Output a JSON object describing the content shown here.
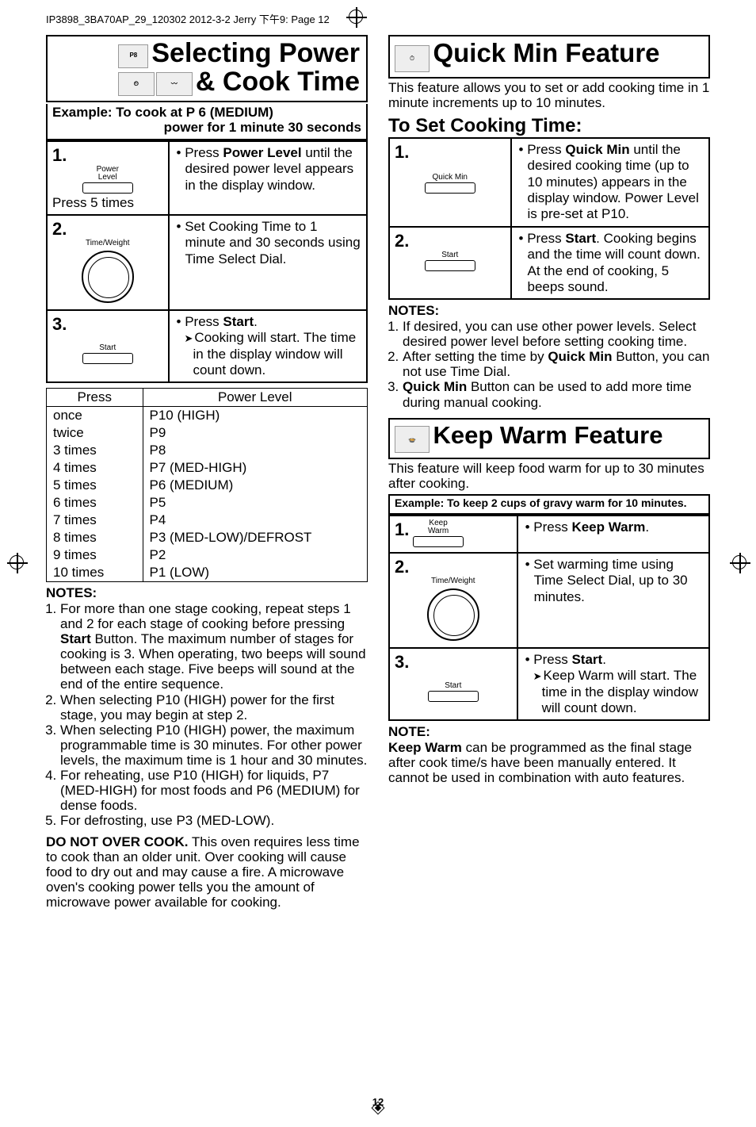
{
  "header": "IP3898_3BA70AP_29_120302  2012-3-2  Jerry 下午9:  Page 12",
  "page_number": "12",
  "left": {
    "title_line1": "Selecting Power",
    "title_line2": "& Cook Time",
    "example_l1": "Example: To cook at P 6 (MEDIUM)",
    "example_l2": "power for 1 minute 30 seconds",
    "steps": [
      {
        "num": "1.",
        "btn_l1": "Power",
        "btn_l2": "Level",
        "extra_text": "Press 5 times",
        "bullets": [
          "• Press ",
          "• Press <b>Power Level</b> until the desired power level appears in the display window."
        ],
        "bullet_html": "Power Level",
        "bullet_after": " until the desired power level appears in the display window."
      },
      {
        "num": "2.",
        "btn_l1": "Time/Weight",
        "bullet": "• Set Cooking Time to 1 minute and 30 seconds using Time Select Dial."
      },
      {
        "num": "3.",
        "btn_l1": "Start",
        "bullet_pre": "• Press ",
        "bullet_bold": "Start",
        "bullet_post": ".",
        "arrow_line": "Cooking will start. The time in the display window will count down."
      }
    ],
    "power_header_l": "Press",
    "power_header_r": "Power Level",
    "power_rows": [
      [
        "once",
        "P10 (HIGH)"
      ],
      [
        "twice",
        "P9"
      ],
      [
        "3 times",
        "P8"
      ],
      [
        "4 times",
        "P7 (MED-HIGH)"
      ],
      [
        "5 times",
        "P6 (MEDIUM)"
      ],
      [
        "6 times",
        "P5"
      ],
      [
        "7 times",
        "P4"
      ],
      [
        "8 times",
        "P3 (MED-LOW)/DEFROST"
      ],
      [
        "9 times",
        "P2"
      ],
      [
        "10 times",
        "P1 (LOW)"
      ]
    ],
    "notes_h": "NOTES:",
    "notes": [
      "For more than one stage cooking, repeat steps 1 and 2 for each stage of cooking before pressing <b>Start</b> Button. The maximum number of stages for cooking is 3. When operating, two beeps will sound between each stage. Five beeps will sound at the end of the entire sequence.",
      "When selecting P10 (HIGH) power for the first stage, you may begin at step 2.",
      "When selecting P10 (HIGH) power, the maximum programmable time is 30 minutes. For other power levels, the maximum time is 1 hour and 30 minutes.",
      "For reheating, use P10 (HIGH) for liquids, P7 (MED-HIGH) for most foods and P6 (MEDIUM) for dense foods.",
      "For defrosting, use P3 (MED-LOW)."
    ],
    "donot": "<b>DO NOT OVER COOK.</b> This oven requires less time to cook than an older unit. Over cooking will cause food to dry out and may cause a fire. A microwave oven's cooking power tells you the amount of microwave power available for cooking."
  },
  "right": {
    "qm_title": "Quick Min Feature",
    "qm_intro": "This feature allows you to set or add cooking time in 1 minute increments up to 10 minutes.",
    "toset": "To Set Cooking Time:",
    "qm_steps": [
      {
        "num": "1.",
        "btn": "Quick Min",
        "bullet_pre": "• Press ",
        "bullet_bold": "Quick Min",
        "bullet_post": " until the desired cooking time (up to 10 minutes) appears in the display window. Power Level is pre-set at P10."
      },
      {
        "num": "2.",
        "btn": "Start",
        "bullet_pre": "• Press ",
        "bullet_bold": "Start",
        "bullet_post": ".",
        "extra": "Cooking begins and the time will count down. At the end of cooking, 5 beeps sound."
      }
    ],
    "qm_notes_h": "NOTES:",
    "qm_notes": [
      "If desired, you can use other power levels. Select desired power level before setting cooking time.",
      "After setting the time by <b>Quick Min</b> Button, you can not use Time Dial.",
      "<b>Quick Min</b> Button can be used to add more time during manual cooking."
    ],
    "kw_title": "Keep Warm Feature",
    "kw_intro": "This feature will keep food warm for up to 30 minutes after cooking.",
    "kw_example": "Example: To keep 2 cups of gravy warm for 10 minutes.",
    "kw_steps": [
      {
        "num": "1.",
        "btn_l1": "Keep",
        "btn_l2": "Warm",
        "bullet_pre": "• Press ",
        "bullet_bold": "Keep Warm",
        "bullet_post": "."
      },
      {
        "num": "2.",
        "btn_l1": "Time/Weight",
        "bullet": "• Set warming time using Time Select Dial, up to 30 minutes."
      },
      {
        "num": "3.",
        "btn_l1": "Start",
        "bullet_pre": "• Press ",
        "bullet_bold": "Start",
        "bullet_post": ".",
        "arrow_line": "Keep Warm will start. The time in the display window will count down."
      }
    ],
    "kw_note_h": "NOTE:",
    "kw_note": "<b>Keep Warm</b> can be programmed as the final stage after cook time/s have been manually entered. It cannot be used in combination with auto features."
  }
}
